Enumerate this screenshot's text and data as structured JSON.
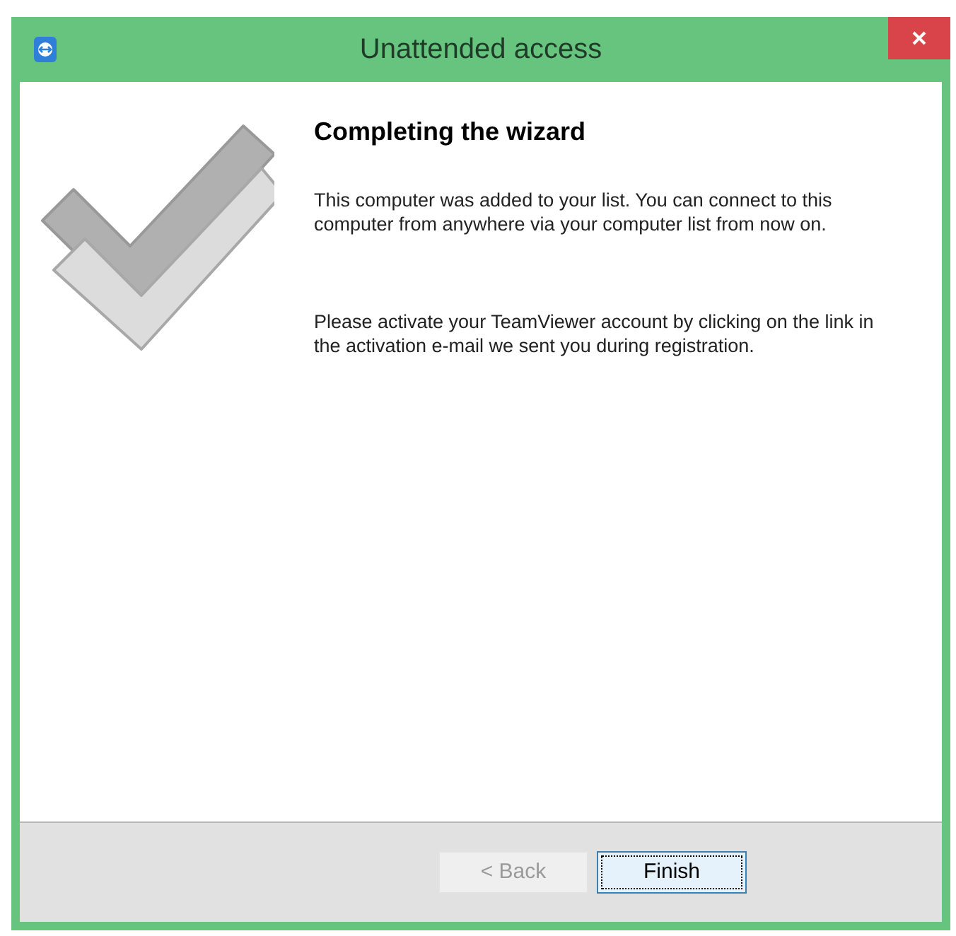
{
  "window": {
    "title": "Unattended access"
  },
  "heading": "Completing the wizard",
  "paragraphs": [
    "This computer was added to your list. You can connect to this computer from anywhere via your computer list from now on.",
    "Please activate your TeamViewer account by clicking on the link in the activation e-mail we sent you during registration."
  ],
  "buttons": [
    {
      "label": "< Back",
      "disabled": true,
      "focused": false
    },
    {
      "label": "Finish",
      "disabled": false,
      "focused": true
    }
  ]
}
